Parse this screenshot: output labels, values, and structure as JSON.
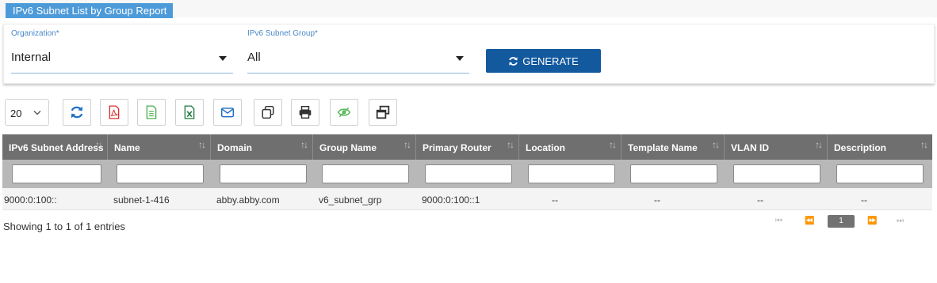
{
  "report": {
    "title": "IPv6 Subnet List by Group Report"
  },
  "filters": {
    "organization": {
      "label": "Organization*",
      "value": "Internal"
    },
    "subnet_group": {
      "label": "IPv6 Subnet Group*",
      "value": "All"
    },
    "generate_label": "GENERATE"
  },
  "toolbar": {
    "page_size": "20",
    "buttons": [
      "refresh-icon",
      "pdf-icon",
      "csv-icon",
      "excel-icon",
      "email-icon",
      "copy-icon",
      "print-icon",
      "eye-slash-icon",
      "window-restore-icon"
    ]
  },
  "table": {
    "columns": [
      "IPv6 Subnet Address",
      "Name",
      "Domain",
      "Group Name",
      "Primary Router",
      "Location",
      "Template Name",
      "VLAN ID",
      "Description"
    ],
    "rows": [
      [
        "9000:0:100::",
        "subnet-1-416",
        "abby.abby.com",
        "v6_subnet_grp",
        "9000:0:100::1",
        "--",
        "--",
        "--",
        "--"
      ]
    ]
  },
  "footer": {
    "showing": "Showing 1 to 1 of 1 entries",
    "pagination": {
      "first": "⏮",
      "prev": "⏪",
      "current": "1",
      "next": "⏩",
      "last": "⏭"
    }
  },
  "colors": {
    "accent": "#12599e",
    "tab": "#4d9ad9",
    "header": "#6f6f6f",
    "label": "#4a88c7"
  }
}
